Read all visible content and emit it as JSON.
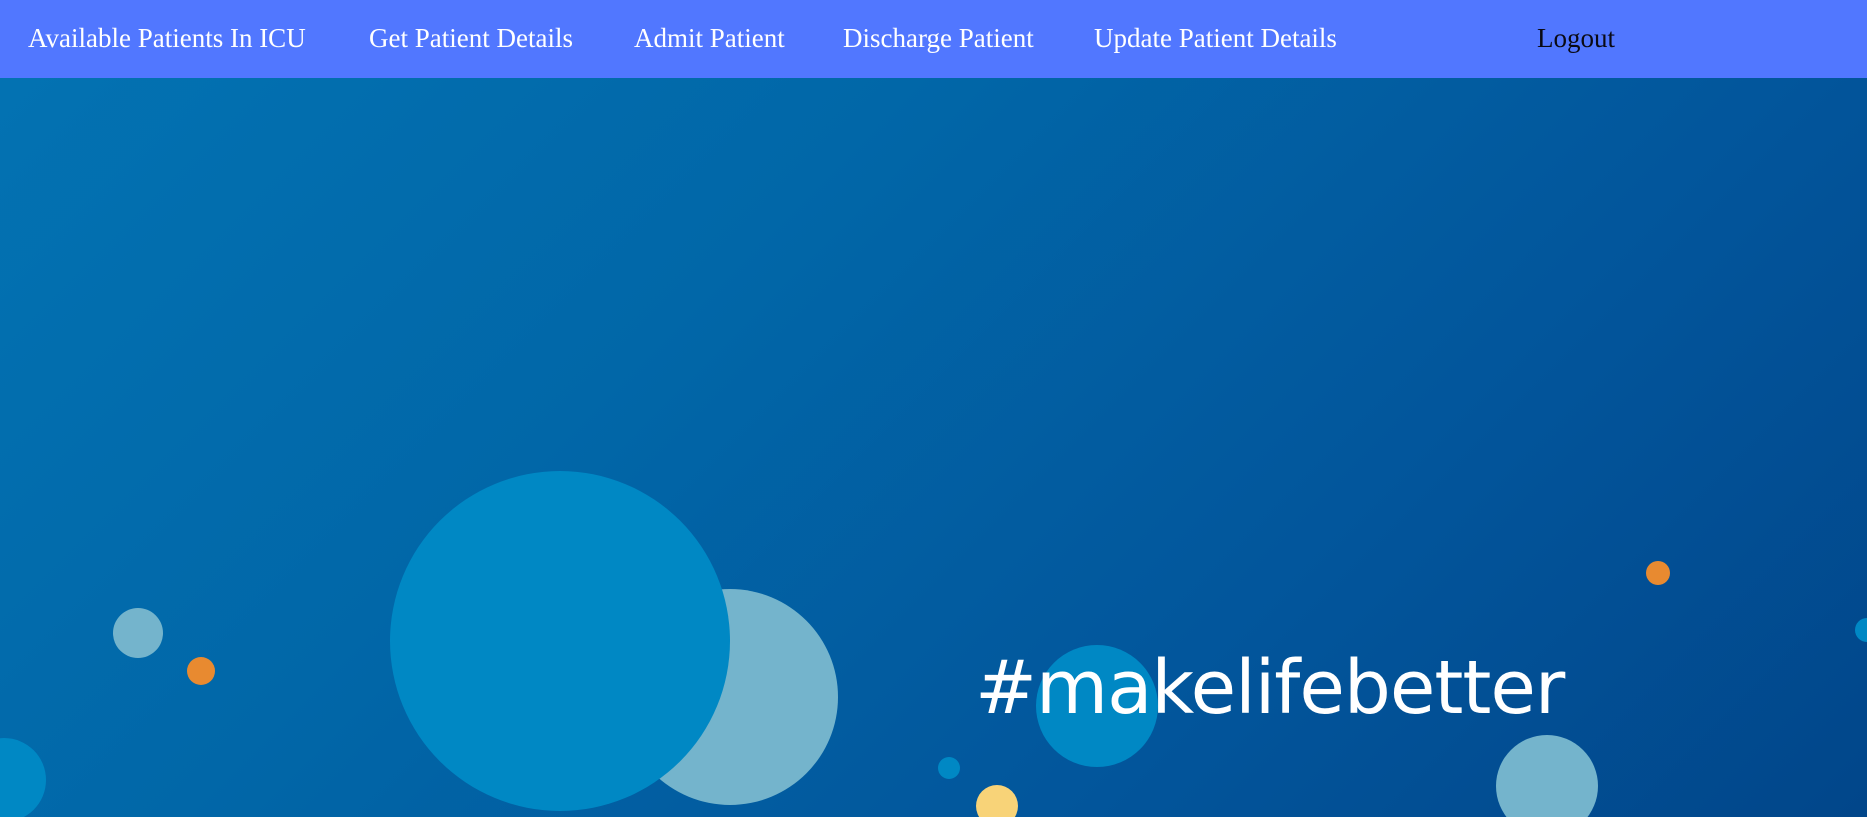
{
  "nav": {
    "items": [
      {
        "label": "Available Patients In ICU"
      },
      {
        "label": "Get Patient Details"
      },
      {
        "label": "Admit Patient"
      },
      {
        "label": "Discharge Patient"
      },
      {
        "label": "Update Patient Details"
      }
    ],
    "logout_label": "Logout"
  },
  "hero": {
    "hashtag": "#makelifebetter"
  },
  "colors": {
    "navbar_bg": "#5177ff",
    "hero_bg": "#0167a8",
    "bubble_blue": "#0088c4",
    "bubble_light": "#74b4cc",
    "bubble_orange": "#e88a30",
    "bubble_yellow": "#f8d378"
  }
}
